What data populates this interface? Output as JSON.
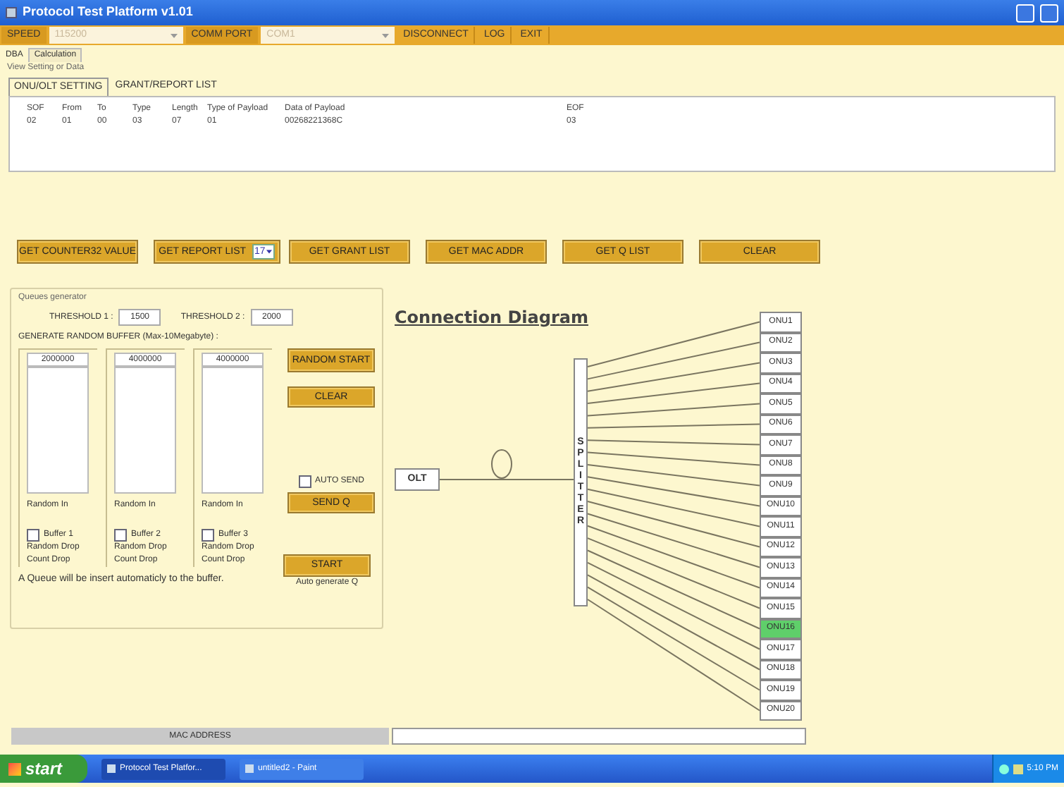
{
  "window": {
    "title": "Protocol Test Platform v1.01"
  },
  "toolbar": {
    "speed_label": "SPEED",
    "speed_value": "115200",
    "comm_label": "COMM PORT",
    "comm_value": "COM1",
    "actions": [
      "DISCONNECT",
      "LOG",
      "EXIT"
    ]
  },
  "tabs": [
    {
      "label": "DBA",
      "selected": true
    },
    {
      "label": "Calculation",
      "selected": false
    }
  ],
  "section_label": "View Setting or Data",
  "sub_tabs": [
    {
      "label": "ONU/OLT SETTING",
      "selected": true
    },
    {
      "label": "GRANT/REPORT LIST",
      "selected": false
    }
  ],
  "table": {
    "columns": [
      "SOF",
      "From",
      "To",
      "Type",
      "Length",
      "Type of Payload",
      "Data of Payload",
      "EOF"
    ],
    "rows": [
      [
        "02",
        "01",
        "00",
        "03",
        "07",
        "01",
        "00268221368C",
        "03"
      ]
    ]
  },
  "actions": [
    {
      "kind": "button",
      "label": "GET COUNTER32 VALUE"
    },
    {
      "kind": "combo",
      "label": "GET REPORT LIST",
      "value": "17"
    },
    {
      "kind": "button",
      "label": "GET GRANT LIST"
    },
    {
      "kind": "button",
      "label": "GET MAC ADDR"
    },
    {
      "kind": "button",
      "label": "GET Q LIST"
    },
    {
      "kind": "button",
      "label": "CLEAR"
    }
  ],
  "queues": {
    "title": "Queues generator",
    "threshold1_label": "THRESHOLD 1 :",
    "threshold1": "1500",
    "threshold2_label": "THRESHOLD 2 :",
    "threshold2": "2000",
    "buffer_label": "GENERATE RANDOM BUFFER (Max-10Megabyte) :",
    "buffers": [
      {
        "value": "2000000",
        "random_in": "Random In",
        "checkbox": "Buffer 1",
        "checked": false,
        "random_drop": "Random Drop",
        "count_drop": "Count Drop"
      },
      {
        "value": "4000000",
        "random_in": "Random In",
        "checkbox": "Buffer 2",
        "checked": false,
        "random_drop": "Random Drop",
        "count_drop": "Count Drop"
      },
      {
        "value": "4000000",
        "random_in": "Random In",
        "checkbox": "Buffer 3",
        "checked": false,
        "random_drop": "Random Drop",
        "count_drop": "Count Drop"
      }
    ],
    "random_start": "RANDOM START",
    "clear": "CLEAR",
    "auto_send": {
      "label": "AUTO SEND",
      "checked": false
    },
    "send_q": "SEND Q",
    "start": "START",
    "auto_generate": "Auto generate Q",
    "note": "A Queue will be insert automaticly to the buffer."
  },
  "diagram": {
    "title": "Connection Diagram",
    "olt": "OLT",
    "splitter": "SPLITTER",
    "onus": [
      {
        "label": "ONU1",
        "selected": false
      },
      {
        "label": "ONU2",
        "selected": false
      },
      {
        "label": "ONU3",
        "selected": false
      },
      {
        "label": "ONU4",
        "selected": false
      },
      {
        "label": "ONU5",
        "selected": false
      },
      {
        "label": "ONU6",
        "selected": false
      },
      {
        "label": "ONU7",
        "selected": false
      },
      {
        "label": "ONU8",
        "selected": false
      },
      {
        "label": "ONU9",
        "selected": false
      },
      {
        "label": "ONU10",
        "selected": false
      },
      {
        "label": "ONU11",
        "selected": false
      },
      {
        "label": "ONU12",
        "selected": false
      },
      {
        "label": "ONU13",
        "selected": false
      },
      {
        "label": "ONU14",
        "selected": false
      },
      {
        "label": "ONU15",
        "selected": false
      },
      {
        "label": "ONU16",
        "selected": true
      },
      {
        "label": "ONU17",
        "selected": false
      },
      {
        "label": "ONU18",
        "selected": false
      },
      {
        "label": "ONU19",
        "selected": false
      },
      {
        "label": "ONU20",
        "selected": false
      }
    ]
  },
  "mac": {
    "label": "MAC ADDRESS"
  },
  "taskbar": {
    "start": "start",
    "items": [
      {
        "label": "Protocol Test Platfor...",
        "selected": true
      },
      {
        "label": "untitled2 - Paint",
        "selected": false
      }
    ],
    "clock": "5:10 PM"
  }
}
